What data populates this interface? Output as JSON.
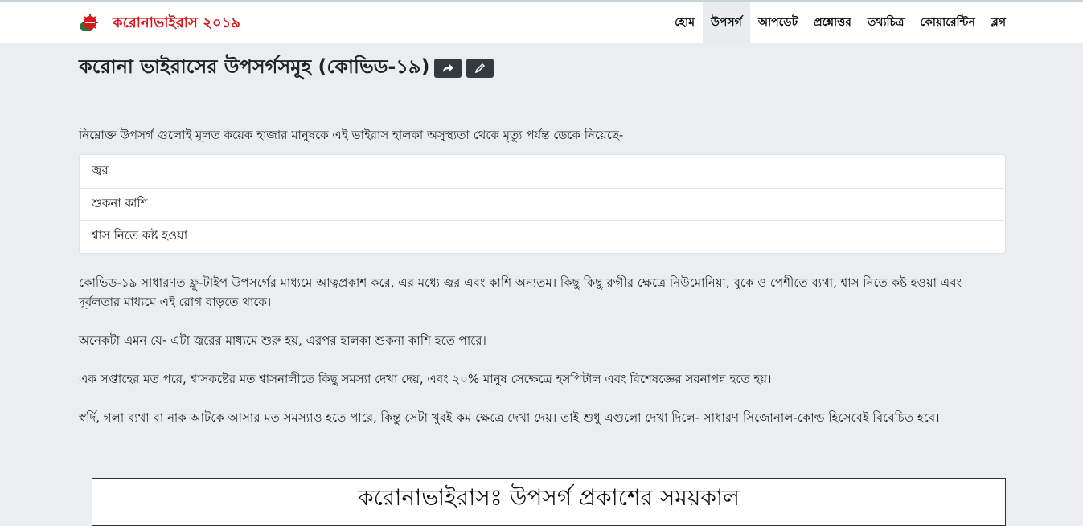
{
  "brand": {
    "name": "করোনাভাইরাস ২০১৯",
    "color": "#d7191f"
  },
  "nav": {
    "items": [
      {
        "label": "হোম",
        "active": false
      },
      {
        "label": "উপসর্গ",
        "active": true
      },
      {
        "label": "আপডেট",
        "active": false
      },
      {
        "label": "প্রশ্নোত্তর",
        "active": false
      },
      {
        "label": "তথ্যচিত্র",
        "active": false
      },
      {
        "label": "কোয়ারেন্টিন",
        "active": false
      },
      {
        "label": "ব্লগ",
        "active": false
      }
    ]
  },
  "page": {
    "title": "করোনা ভাইরাসের উপসর্গসমূহ (কোভিড-১৯)",
    "share_icon": "share-icon",
    "edit_icon": "pencil-icon",
    "intro": "নিম্নোক্ত উপসর্গ গুলোই মূলত কয়েক হাজার মানুষকে এই ভাইরাস হালকা অসুস্থ্যতা থেকে মৃত্যু পর্যন্ত ডেকে নিয়েছে-",
    "symptoms": [
      "জ্বর",
      "শুকনা কাশি",
      "শ্বাস নিতে কষ্ট হওয়া"
    ],
    "paragraphs": [
      "কোভিড-১৯ সাধারণত ফ্লু-টাইপ উপসর্গের মাধ্যমে আত্বপ্রকাশ করে, এর মধ্যে জ্বর এবং কাশি অন্যতম। কিছু কিছু রুগীর ক্ষেত্রে নিউমোনিয়া, বুকে ও পেশীতে ব্যথা, শ্বাস নিতে কষ্ট হওয়া এবং দূর্বলতার মাধ্যমে এই রোগ বাড়তে থাকে।",
      "অনেকটা এমন যে- এটা জ্বরের মাধ্যমে শুরু হয়, এরপর হালকা শুকনা কাশি হতে পারে।",
      "এক সপ্তাহের মত পরে, শ্বাসকষ্টের মত শ্বাসনালীতে কিছু সমস্যা দেখা দেয়, এবং ২০% মানুষ সেক্ষেত্রে হসপিটাল এবং বিশেষজ্ঞের সরনাপন্ন হতে হয়।",
      "স্বর্দি, গলা ব্যথা বা নাক আটকে আসার মত সমস্যাও হতে পারে, কিন্তু সেটা খুবই কম ক্ষেত্রে দেখা দেয়। তাই শুধু এগুলো দেখা দিলে- সাধারণ সিজোনাল-কোল্ড হিসেবেই বিবেচিত হবে।"
    ],
    "timeline_title": "করোনাভাইরাসঃ উপসর্গ প্রকাশের সময়কাল"
  }
}
